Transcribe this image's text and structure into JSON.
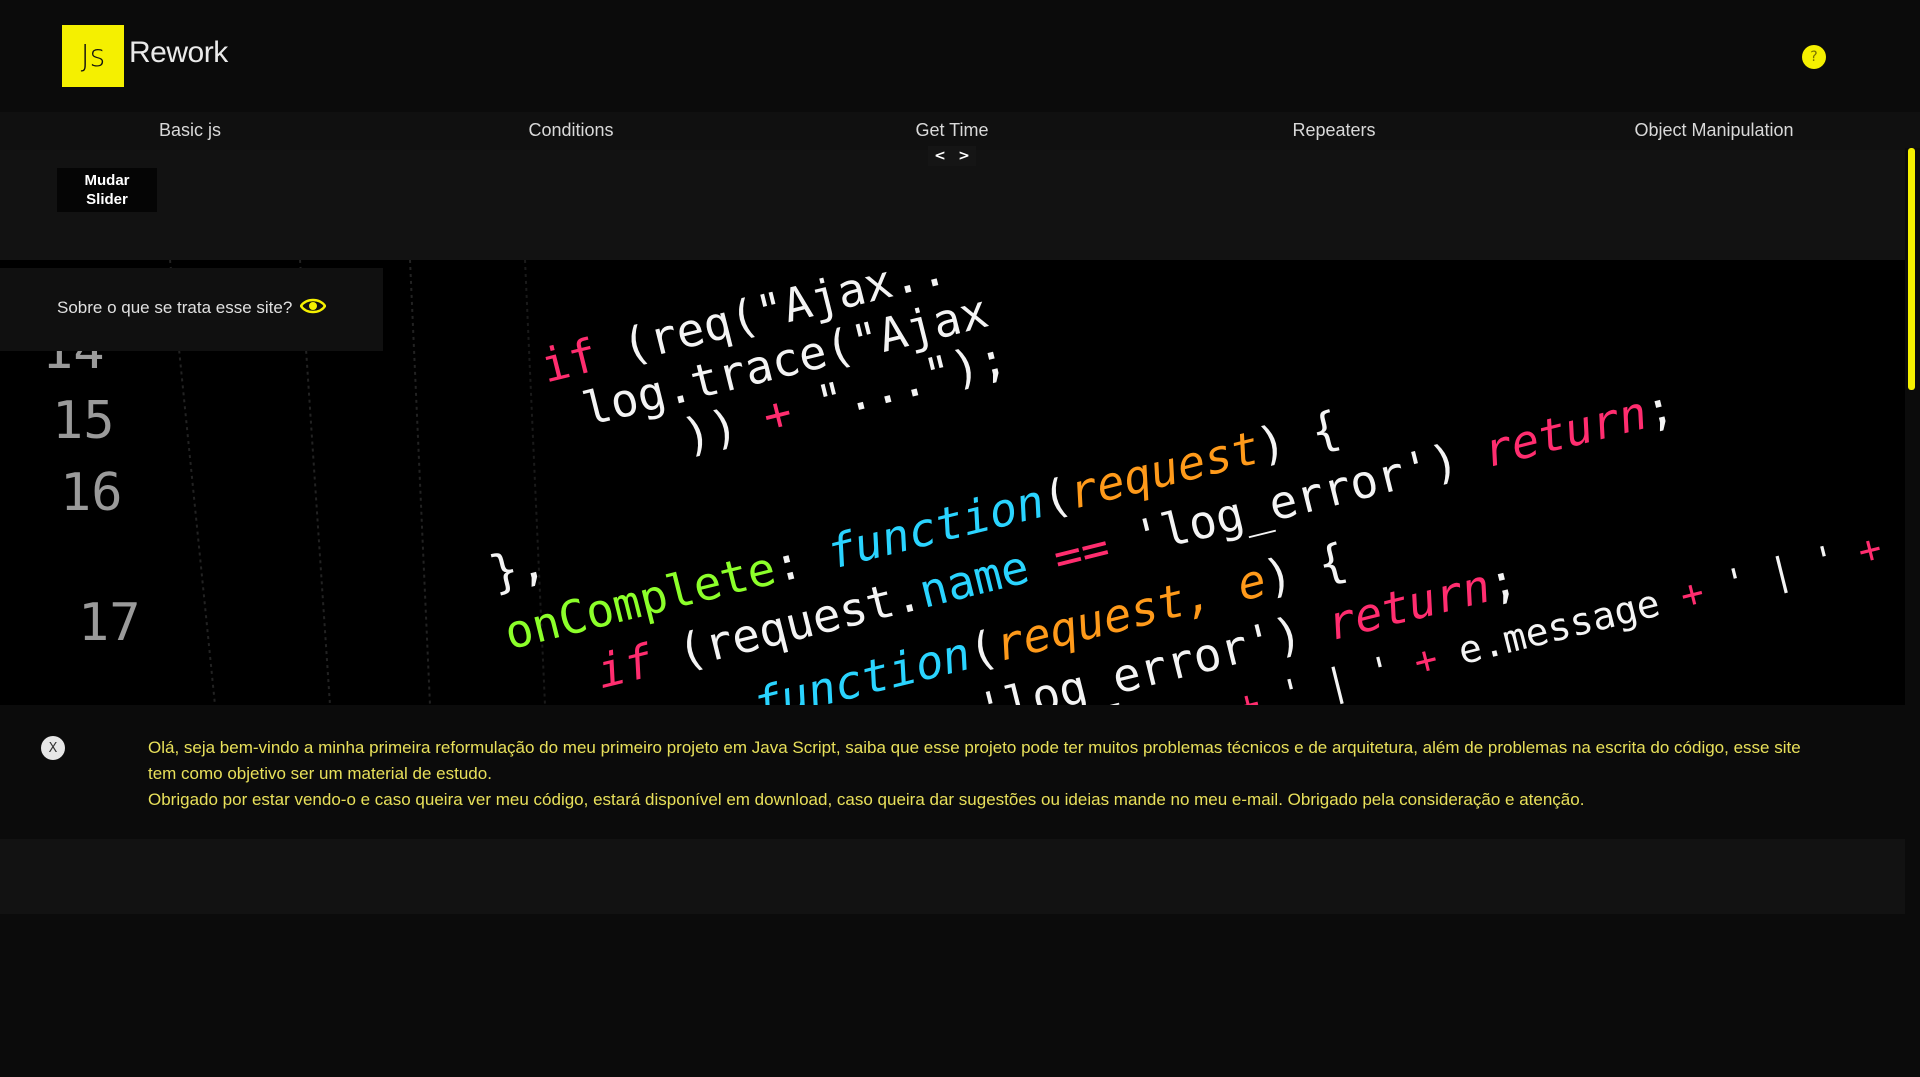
{
  "header": {
    "logo_mark": "Js",
    "logo_text": "Rework",
    "help_label": "?"
  },
  "nav": {
    "items": [
      {
        "label": "Basic js"
      },
      {
        "label": "Conditions"
      },
      {
        "label": "Get Time"
      },
      {
        "label": "Repeaters"
      },
      {
        "label": "Object Manipulation"
      }
    ]
  },
  "slider": {
    "prev_label": "<",
    "next_label": ">",
    "change_button_line1": "Mudar",
    "change_button_line2": "Slider"
  },
  "about": {
    "question": "Sobre o que se trata esse site?"
  },
  "notice": {
    "close_label": "X",
    "paragraph1": "Olá, seja bem-vindo a minha primeira reformulação do meu primeiro projeto em Java Script, saiba que esse projeto pode ter muitos problemas técnicos e de arquitetura, além de problemas na escrita do código, esse site tem como objetivo ser um material de estudo.",
    "paragraph2": "Obrigado por estar vendo-o e caso queira ver meu código, estará disponível em download, caso queira dar sugestões ou ideias mande no meu e-mail. Obrigado pela consideração e atenção."
  },
  "hero_code": {
    "line_numbers": [
      "14",
      "15",
      "16",
      "17"
    ],
    "lines": [
      "if (req(\"Ajax..",
      "log.trace(\"Ajax",
      ")) + \"...\");",
      "},",
      "onComplete: function(request) {",
      "if (request.name == 'log_error') return;",
      "ption: function(request, e) {",
      "uest.name == 'log_error') return;",
      "est.url + ' : ' + e.name + ' | ' + e.message + ' | ' +"
    ]
  },
  "colors": {
    "accent": "#f5f000",
    "background": "#0b0b0b",
    "notice_text": "#e8e05a"
  }
}
